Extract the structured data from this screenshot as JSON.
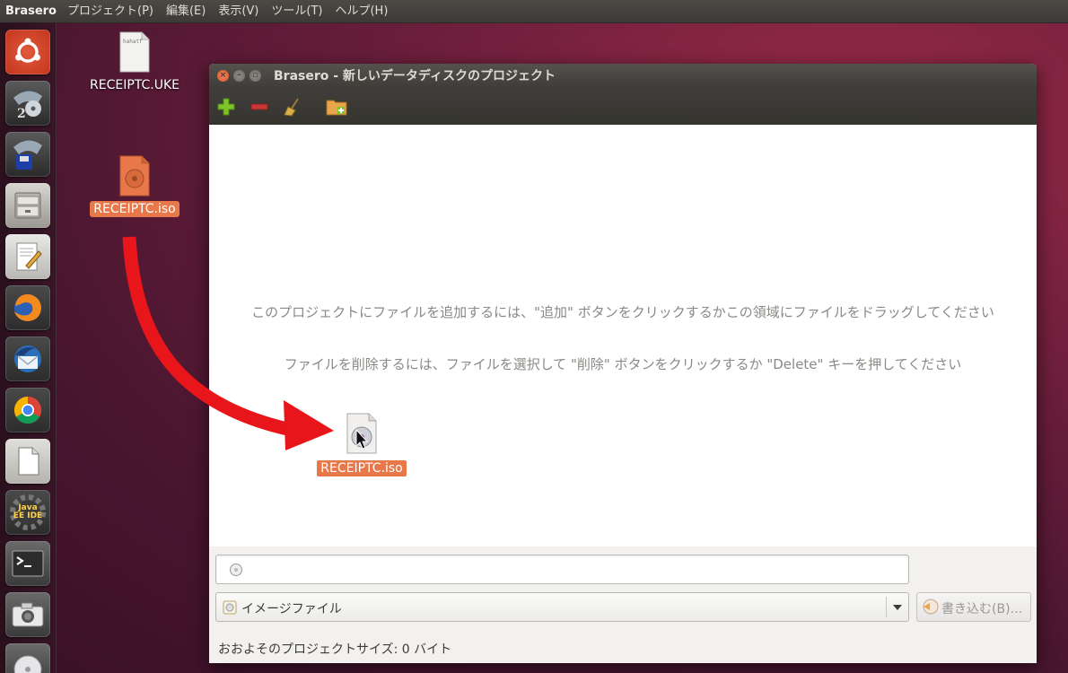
{
  "topbar": {
    "app_name": "Brasero",
    "menus": [
      "プロジェクト(P)",
      "編集(E)",
      "表示(V)",
      "ツール(T)",
      "ヘルプ(H)"
    ]
  },
  "launcher": {
    "items": [
      "ubuntu-dash",
      "brasero-2",
      "brasero-save",
      "file-cabinet",
      "text-editor",
      "firefox",
      "thunderbird",
      "chrome",
      "libreoffice",
      "java-ee-ide",
      "terminal",
      "camera",
      "disc"
    ],
    "java_label": "Java EE IDE"
  },
  "desktop": {
    "file1": {
      "name": "RECEIPTC.UKE",
      "preview": "hahatf"
    },
    "file2": {
      "name": "RECEIPTC.iso"
    }
  },
  "window": {
    "title": "Brasero - 新しいデータディスクのプロジェクト",
    "hint_add": "このプロジェクトにファイルを追加するには、\"追加\" ボタンをクリックするかこの領域にファイルをドラッグしてください",
    "hint_delete": "ファイルを削除するには、ファイルを選択して \"削除\" ボタンをクリックするか \"Delete\" キーを押してください",
    "drag_label": "RECEIPTC.iso",
    "disc_name_value": "",
    "target_select": "イメージファイル",
    "burn_button": "書き込む(B)…",
    "status": "おおよそのプロジェクトサイズ: 0 バイト"
  },
  "colors": {
    "accent": "#e8784a",
    "add": "#7ec32a",
    "remove": "#c83838",
    "arrow": "#e8151a"
  }
}
